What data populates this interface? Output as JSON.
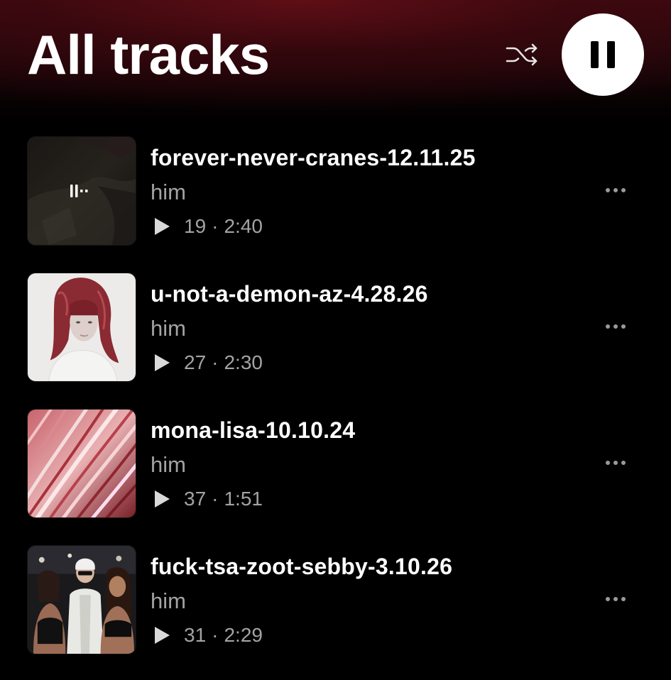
{
  "header": {
    "title": "All tracks",
    "shuffle_icon": "shuffle-icon",
    "play_pause_icon": "pause-icon"
  },
  "tracks": [
    {
      "title": "forever-never-cranes-12.11.25",
      "artist": "him",
      "plays": "19",
      "separator": "·",
      "duration": "2:40",
      "now_playing": true,
      "art": "dark-photo"
    },
    {
      "title": "u-not-a-demon-az-4.28.26",
      "artist": "him",
      "plays": "27",
      "separator": "·",
      "duration": "2:30",
      "now_playing": false,
      "art": "portrait-red-hair"
    },
    {
      "title": "mona-lisa-10.10.24",
      "artist": "him",
      "plays": "37",
      "separator": "·",
      "duration": "1:51",
      "now_playing": false,
      "art": "pink-streaks"
    },
    {
      "title": "fuck-tsa-zoot-sebby-3.10.26",
      "artist": "him",
      "plays": "31",
      "separator": "·",
      "duration": "2:29",
      "now_playing": false,
      "art": "group-photo"
    }
  ],
  "colors": {
    "background": "#000000",
    "header_gradient": "#3b0a10",
    "secondary_text": "#a3a3a3"
  }
}
